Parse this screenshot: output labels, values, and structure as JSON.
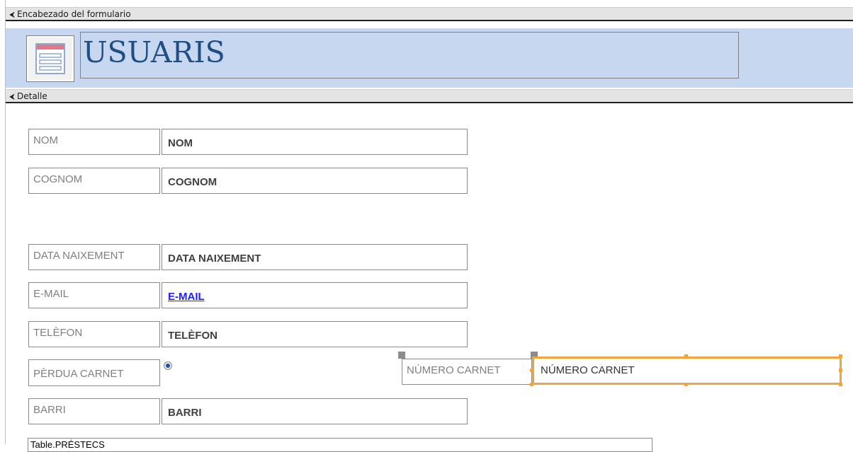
{
  "sections": {
    "header": "Encabezado del formulario",
    "detail": "Detalle"
  },
  "form": {
    "title": "USUARIS"
  },
  "fields": [
    {
      "label": "NOM",
      "value": "NOM"
    },
    {
      "label": "COGNOM",
      "value": "COGNOM"
    },
    {
      "label": "DATA NAIXEMENT",
      "value": "DATA NAIXEMENT"
    },
    {
      "label": "E-MAIL",
      "value": "E-MAIL"
    },
    {
      "label": "TELÈFON",
      "value": "TELÈFON"
    },
    {
      "label": "PÈRDUA CARNET",
      "value": ""
    },
    {
      "label": "BARRI",
      "value": "BARRI"
    }
  ],
  "numero_carnet": {
    "label": "NÚMERO CARNET",
    "value": "NÚMERO CARNET"
  },
  "subform": {
    "label": "Table.PRÉSTECS"
  },
  "colors": {
    "header_band": "#c7d7ef",
    "title": "#1f4e85",
    "selection": "#f3a53b",
    "link": "#1f1fff"
  }
}
